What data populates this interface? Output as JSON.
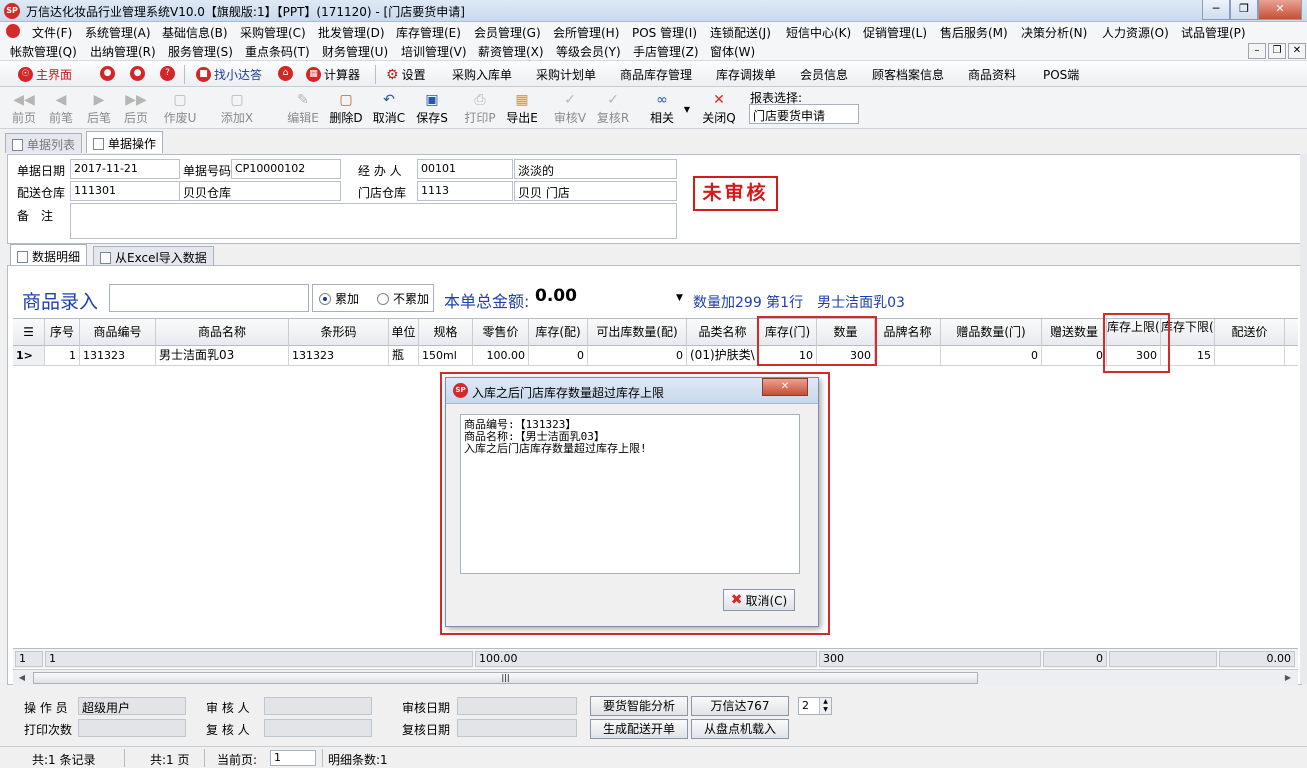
{
  "window": {
    "title": "万信达化妆品行业管理系统V10.0【旗舰版:1】【PPT】(171120) - [门店要货申请]",
    "icon_text": "SP"
  },
  "menu": {
    "row1": [
      "文件(F)",
      "系统管理(A)",
      "基础信息(B)",
      "采购管理(C)",
      "批发管理(D)",
      "库存管理(E)",
      "会员管理(G)",
      "会所管理(H)",
      "POS 管理(I)",
      "连锁配送(J)",
      "短信中心(K)",
      "促销管理(L)",
      "售后服务(M)",
      "决策分析(N)",
      "人力资源(O)",
      "试品管理(P)"
    ],
    "row2": [
      "帐款管理(Q)",
      "出纳管理(R)",
      "服务管理(S)",
      "重点条码(T)",
      "财务管理(U)",
      "培训管理(V)",
      "薪资管理(X)",
      "等级会员(Y)",
      "手店管理(Z)",
      "窗体(W)"
    ]
  },
  "quickbar": {
    "main": "主界面",
    "find": "找小达答",
    "calc": "计算器",
    "settings": "设置",
    "links": [
      "采购入库单",
      "采购计划单",
      "商品库存管理",
      "库存调拨单",
      "会员信息",
      "顾客档案信息",
      "商品资料",
      "POS端"
    ]
  },
  "toolbar": {
    "first": "前页",
    "prev": "前笔",
    "next": "后笔",
    "last": "后页",
    "void": "作废U",
    "add": "添加X",
    "edit": "编辑E",
    "delete": "删除D",
    "cancel": "取消C",
    "save": "保存S",
    "print": "打印P",
    "export": "导出E",
    "audit": "审核V",
    "reaudit": "复核R",
    "related": "相关",
    "close": "关闭Q",
    "report_label": "报表选择:",
    "report_value": "门店要货申请"
  },
  "tabs": {
    "list": "单据列表",
    "operate": "单据操作",
    "detail": "数据明细",
    "excel": "从Excel导入数据"
  },
  "header": {
    "date_label": "单据日期",
    "date": "2017-11-21",
    "no_label": "单据号码",
    "no": "CP10000102",
    "handler_label": "经 办 人",
    "handler_code": "00101",
    "handler_name": "淡淡的",
    "ship_wh_label": "配送仓库",
    "ship_wh_code": "111301",
    "ship_wh_name": "贝贝仓库",
    "store_wh_label": "门店仓库",
    "store_wh_code": "1113",
    "store_wh_name": "贝贝 门店",
    "remark_label": "备　注",
    "status": "未审核"
  },
  "entry": {
    "label": "商品录入",
    "mode_add": "累加",
    "mode_noadd": "不累加",
    "total_label": "本单总金额:",
    "total_value": "0.00",
    "info": "数量加299 第1行　男士洁面乳03"
  },
  "grid": {
    "headers": {
      "seq": "序号",
      "code": "商品编号",
      "name": "商品名称",
      "barcode": "条形码",
      "unit": "单位",
      "spec": "规格",
      "price": "零售价",
      "stock_ship": "库存(配)",
      "avail": "可出库数量(配)",
      "category": "品类名称",
      "stock_store": "库存(门)",
      "qty": "数量",
      "brand": "品牌名称",
      "gift_qty": "赠品数量(门)",
      "gift": "赠送数量",
      "upper": "库存上限(门)",
      "lower": "库存下限(门)",
      "ship_price": "配送价"
    },
    "rows": [
      {
        "marker": "1>",
        "seq": "1",
        "code": "131323",
        "name": "男士洁面乳03",
        "barcode": "131323",
        "unit": "瓶",
        "spec": "150ml",
        "price": "100.00",
        "stock_ship": "0",
        "avail": "0",
        "category": "(01)护肤类\\",
        "stock_store": "10",
        "qty": "300",
        "brand": "",
        "gift_qty": "0",
        "gift": "0",
        "upper": "300",
        "lower": "15",
        "ship_price": ""
      }
    ],
    "footer": {
      "count": "1",
      "seq": "1",
      "price": "100.00",
      "qty": "300",
      "gift": "0",
      "ship_price": "0.00"
    }
  },
  "dialog": {
    "title": "入库之后门店库存数量超过库存上限",
    "lines": [
      "商品编号:【131323】",
      "商品名称:【男士洁面乳03】",
      "入库之后门店库存数量超过库存上限!"
    ],
    "cancel": "取消(C)"
  },
  "bottom": {
    "operator_label": "操 作 员",
    "operator": "超级用户",
    "auditor_label": "审 核 人",
    "audit_date_label": "审核日期",
    "print_label": "打印次数",
    "reviewer_label": "复 核 人",
    "review_date_label": "复核日期",
    "btn_analysis": "要货智能分析",
    "btn_wxd": "万信达767",
    "spin_value": "2",
    "btn_generate": "生成配送开单",
    "btn_load": "从盘点机载入"
  },
  "status": {
    "records": "共:1 条记录",
    "pages": "共:1 页",
    "current_label": "当前页:",
    "current": "1",
    "detail_count": "明细条数:1"
  },
  "colors": {
    "accent_red": "#d42a2a",
    "label_blue": "#1e3fae"
  }
}
